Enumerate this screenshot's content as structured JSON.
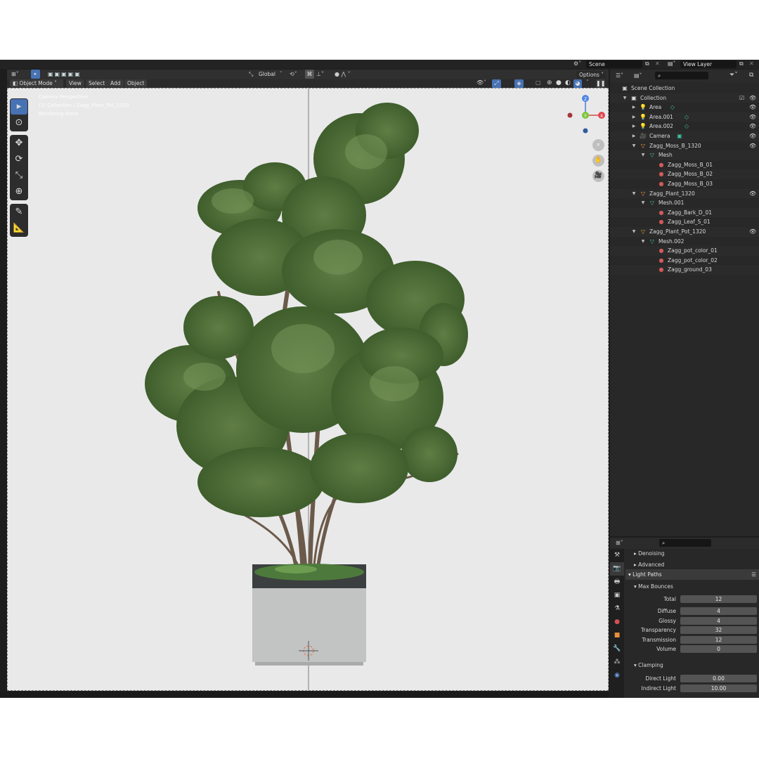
{
  "topbar": {
    "scene": "Scene",
    "view_layer": "View Layer"
  },
  "viewport_header": {
    "orientation": "Global",
    "options": "Options",
    "mode": "Object Mode",
    "menus": [
      "View",
      "Select",
      "Add",
      "Object"
    ]
  },
  "viewport": {
    "info_lines": [
      "Camera Perspective",
      "(1) Collection | Zagg_Plant_Pot_1320",
      "Rendering Done"
    ],
    "gizmo": {
      "z": "Z",
      "y": "Y",
      "x": "X"
    }
  },
  "toolbar_icons": [
    "select-box-icon",
    "cursor-icon",
    "move-icon",
    "rotate-icon",
    "scale-icon",
    "transform-icon",
    "annotate-icon",
    "measure-icon"
  ],
  "outliner": {
    "items": [
      {
        "label": "Scene Collection",
        "indent": 0,
        "icon": "▣",
        "icon_color": "#d0d0d0",
        "eye": ""
      },
      {
        "label": "Collection",
        "indent": 1,
        "icon": "▣",
        "icon_color": "#e0e0e0",
        "eye": "👁",
        "tri": "▼"
      },
      {
        "label": "Area",
        "indent": 2,
        "icon": "💡",
        "icon_color": "#e8a060",
        "eye": "👁",
        "tri": "▶",
        "extra": "◇"
      },
      {
        "label": "Area.001",
        "indent": 2,
        "icon": "💡",
        "icon_color": "#e8a060",
        "eye": "👁",
        "tri": "▶",
        "extra": "◇"
      },
      {
        "label": "Area.002",
        "indent": 2,
        "icon": "💡",
        "icon_color": "#e8a060",
        "eye": "👁",
        "tri": "▶",
        "extra": "◇"
      },
      {
        "label": "Camera",
        "indent": 2,
        "icon": "🎥",
        "icon_color": "#e8a060",
        "eye": "👁",
        "tri": "▶",
        "extra": "▣"
      },
      {
        "label": "Zagg_Moss_B_1320",
        "indent": 2,
        "icon": "▽",
        "icon_color": "#e89a3c",
        "eye": "👁",
        "tri": "▼"
      },
      {
        "label": "Mesh",
        "indent": 3,
        "icon": "▽",
        "icon_color": "#3fc0a0",
        "eye": "",
        "tri": "▼"
      },
      {
        "label": "Zagg_Moss_B_01",
        "indent": 4,
        "icon": "●",
        "icon_color": "#d25a5a",
        "eye": ""
      },
      {
        "label": "Zagg_Moss_B_02",
        "indent": 4,
        "icon": "●",
        "icon_color": "#d25a5a",
        "eye": ""
      },
      {
        "label": "Zagg_Moss_B_03",
        "indent": 4,
        "icon": "●",
        "icon_color": "#d25a5a",
        "eye": ""
      },
      {
        "label": "Zagg_Plant_1320",
        "indent": 2,
        "icon": "▽",
        "icon_color": "#e89a3c",
        "eye": "👁",
        "tri": "▼"
      },
      {
        "label": "Mesh.001",
        "indent": 3,
        "icon": "▽",
        "icon_color": "#3fc0a0",
        "eye": "",
        "tri": "▼"
      },
      {
        "label": "Zagg_Bark_D_01",
        "indent": 4,
        "icon": "●",
        "icon_color": "#d25a5a",
        "eye": ""
      },
      {
        "label": "Zagg_Leaf_S_01",
        "indent": 4,
        "icon": "●",
        "icon_color": "#d25a5a",
        "eye": ""
      },
      {
        "label": "Zagg_Plant_Pot_1320",
        "indent": 2,
        "icon": "▽",
        "icon_color": "#e89a3c",
        "eye": "👁",
        "tri": "▼"
      },
      {
        "label": "Mesh.002",
        "indent": 3,
        "icon": "▽",
        "icon_color": "#3fc0a0",
        "eye": "",
        "tri": "▼"
      },
      {
        "label": "Zagg_pot_color_01",
        "indent": 4,
        "icon": "●",
        "icon_color": "#d25a5a",
        "eye": ""
      },
      {
        "label": "Zagg_pot_color_02",
        "indent": 4,
        "icon": "●",
        "icon_color": "#d25a5a",
        "eye": ""
      },
      {
        "label": "Zagg_ground_03",
        "indent": 4,
        "icon": "●",
        "icon_color": "#d25a5a",
        "eye": ""
      }
    ]
  },
  "properties": {
    "sections": {
      "denoising": "Denoising",
      "advanced": "Advanced",
      "light_paths": "Light Paths",
      "max_bounces": "Max Bounces",
      "clamping": "Clamping"
    },
    "bounces": [
      {
        "label": "Total",
        "value": "12"
      },
      {
        "label": "Diffuse",
        "value": "4"
      },
      {
        "label": "Glossy",
        "value": "4"
      },
      {
        "label": "Transparency",
        "value": "32"
      },
      {
        "label": "Transmission",
        "value": "12"
      },
      {
        "label": "Volume",
        "value": "0"
      }
    ],
    "clamping": [
      {
        "label": "Direct Light",
        "value": "0.00"
      },
      {
        "label": "Indirect Light",
        "value": "10.00"
      }
    ]
  }
}
